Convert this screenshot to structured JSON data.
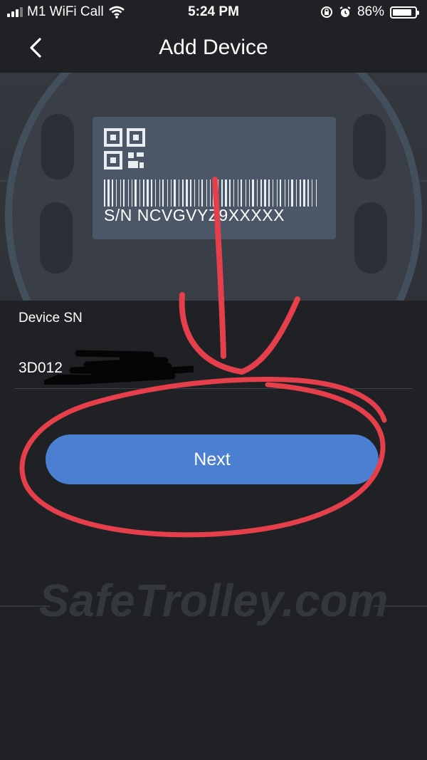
{
  "status_bar": {
    "carrier": "M1 WiFi Call",
    "time": "5:24 PM",
    "battery_percent": "86%",
    "battery_level": 0.86
  },
  "nav": {
    "title": "Add Device"
  },
  "hero": {
    "serial_label": "S/N  NCVGVYZ9XXXXX",
    "watermark": "SafeTrolley.com"
  },
  "form": {
    "device_sn_label": "Device SN",
    "device_sn_value": "3D012"
  },
  "actions": {
    "next_label": "Next"
  },
  "watermark": {
    "text": "SafeTrolley.com"
  },
  "colors": {
    "background": "#1f2124",
    "accent": "#4a7fd1",
    "annotation": "#e53f4c"
  }
}
